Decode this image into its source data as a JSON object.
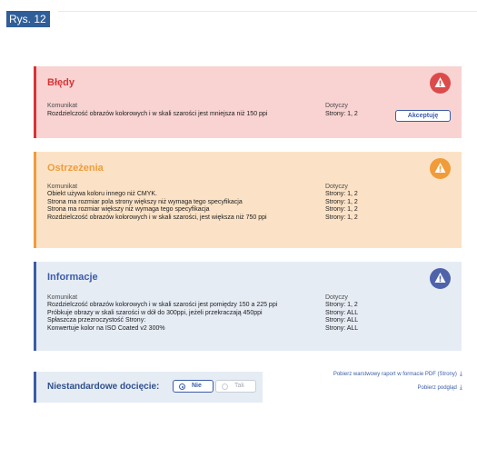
{
  "figure": {
    "label": "Rys. 12"
  },
  "errors": {
    "title": "Błędy",
    "icon": "alert-triangle-icon",
    "col_message": "Komunikat",
    "col_pages": "Dotyczy",
    "rows": [
      {
        "message": "Rozdzielczość obrazów kolorowych i w skali szarości jest mniejsza niż 150 ppi",
        "pages": "Strony: 1, 2"
      }
    ],
    "accept_label": "Akceptuję",
    "color": "#d83336"
  },
  "warnings": {
    "title": "Ostrzeżenia",
    "icon": "alert-triangle-icon",
    "col_message": "Komunikat",
    "col_pages": "Dotyczy",
    "rows": [
      {
        "message": "Obiekt używa koloru innego niż CMYK.",
        "pages": "Strony: 1, 2"
      },
      {
        "message": "Strona ma rozmiar pola strony większy niż wymaga tego specyfikacja",
        "pages": "Strony: 1, 2"
      },
      {
        "message": "Strona ma rozmiar większy niż wymaga tego specyfikacja",
        "pages": "Strony: 1, 2"
      },
      {
        "message": "Rozdzielczość obrazów kolorowych i w skali szarości, jest większa niż 750 ppi",
        "pages": "Strony: 1, 2"
      }
    ],
    "color": "#f09c3c"
  },
  "info": {
    "title": "Informacje",
    "icon": "alert-triangle-icon",
    "col_message": "Komunikat",
    "col_pages": "Dotyczy",
    "rows": [
      {
        "message": "Rozdzielczość obrazów kolorowych i w skali szarości jest pomiędzy 150 a 225 ppi",
        "pages": "Strony: 1, 2"
      },
      {
        "message": "Próbkuje obrazy w skali szarości w dół do 300ppi, jeżeli przekraczają 450ppi",
        "pages": "Strony: ALL"
      },
      {
        "message": "Spłaszcza przezroczystość Strony:",
        "pages": "Strony: ALL"
      },
      {
        "message": "Konwertuje kolor na ISO Coated v2 300%",
        "pages": "Strony: ALL"
      }
    ],
    "color": "#3c5ca8"
  },
  "trim": {
    "label": "Niestandardowe docięcie:",
    "options": [
      {
        "label": "Nie",
        "selected": true
      },
      {
        "label": "Tak",
        "selected": false
      }
    ]
  },
  "downloads": {
    "layered_pdf": "Pobierz warstwowy raport w formacie PDF (Strony)",
    "preview": "Pobierz podgląd",
    "icon": "download-icon"
  }
}
